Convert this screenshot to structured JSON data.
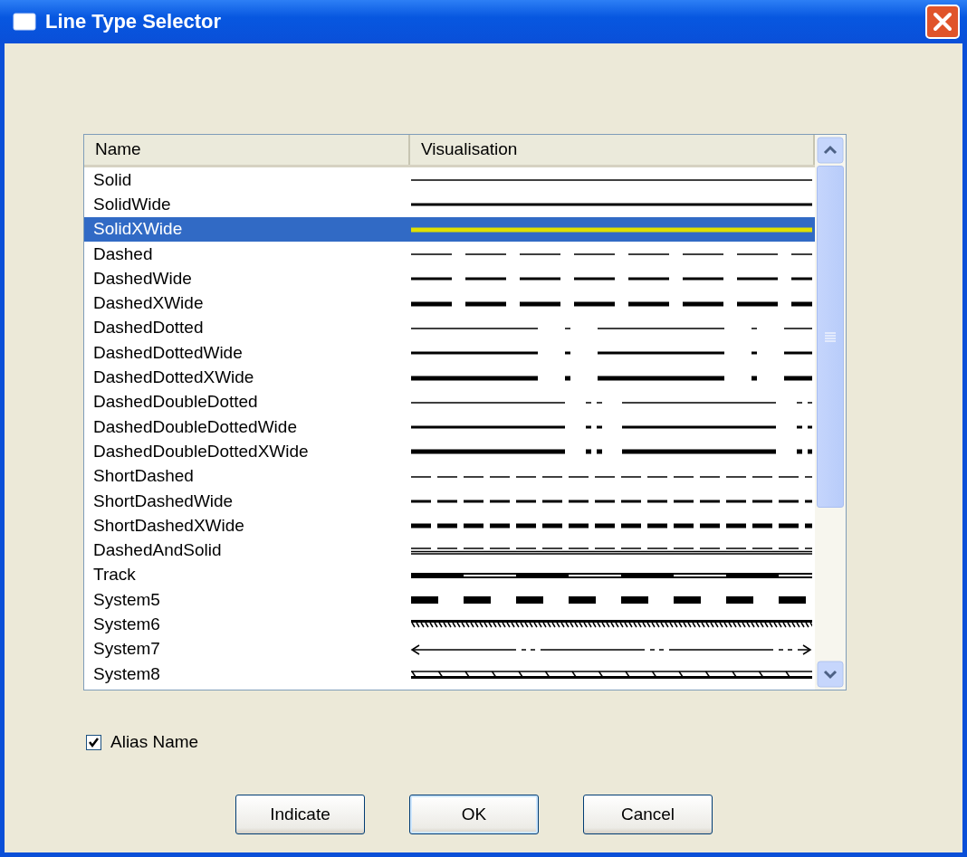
{
  "window": {
    "title": "Line Type Selector"
  },
  "table": {
    "columns": [
      "Name",
      "Visualisation"
    ],
    "rows": [
      {
        "name": "Solid",
        "kind": "solid",
        "selected": false
      },
      {
        "name": "SolidWide",
        "kind": "solidwide",
        "selected": false
      },
      {
        "name": "SolidXWide",
        "kind": "solidxwide",
        "selected": true
      },
      {
        "name": "Dashed",
        "kind": "dashed",
        "selected": false
      },
      {
        "name": "DashedWide",
        "kind": "dashedwide",
        "selected": false
      },
      {
        "name": "DashedXWide",
        "kind": "dashedxwide",
        "selected": false
      },
      {
        "name": "DashedDotted",
        "kind": "dashdot",
        "selected": false
      },
      {
        "name": "DashedDottedWide",
        "kind": "dashdotwide",
        "selected": false
      },
      {
        "name": "DashedDottedXWide",
        "kind": "dashdotxwide",
        "selected": false
      },
      {
        "name": "DashedDoubleDotted",
        "kind": "dashdoubledot",
        "selected": false
      },
      {
        "name": "DashedDoubleDottedWide",
        "kind": "dashdoubledotwide",
        "selected": false
      },
      {
        "name": "DashedDoubleDottedXWide",
        "kind": "dashdoubledotxwide",
        "selected": false
      },
      {
        "name": "ShortDashed",
        "kind": "shortdash",
        "selected": false
      },
      {
        "name": "ShortDashedWide",
        "kind": "shortdashwide",
        "selected": false
      },
      {
        "name": "ShortDashedXWide",
        "kind": "shortdashxwide",
        "selected": false
      },
      {
        "name": "DashedAndSolid",
        "kind": "dashsolid",
        "selected": false
      },
      {
        "name": "Track",
        "kind": "track",
        "selected": false
      },
      {
        "name": "System5",
        "kind": "blocks",
        "selected": false
      },
      {
        "name": "System6",
        "kind": "hatch",
        "selected": false
      },
      {
        "name": "System7",
        "kind": "arrow",
        "selected": false
      },
      {
        "name": "System8",
        "kind": "rail",
        "selected": false
      }
    ]
  },
  "alias_name": {
    "label": "Alias Name",
    "checked": true
  },
  "buttons": [
    "Indicate",
    "OK",
    "Cancel"
  ]
}
